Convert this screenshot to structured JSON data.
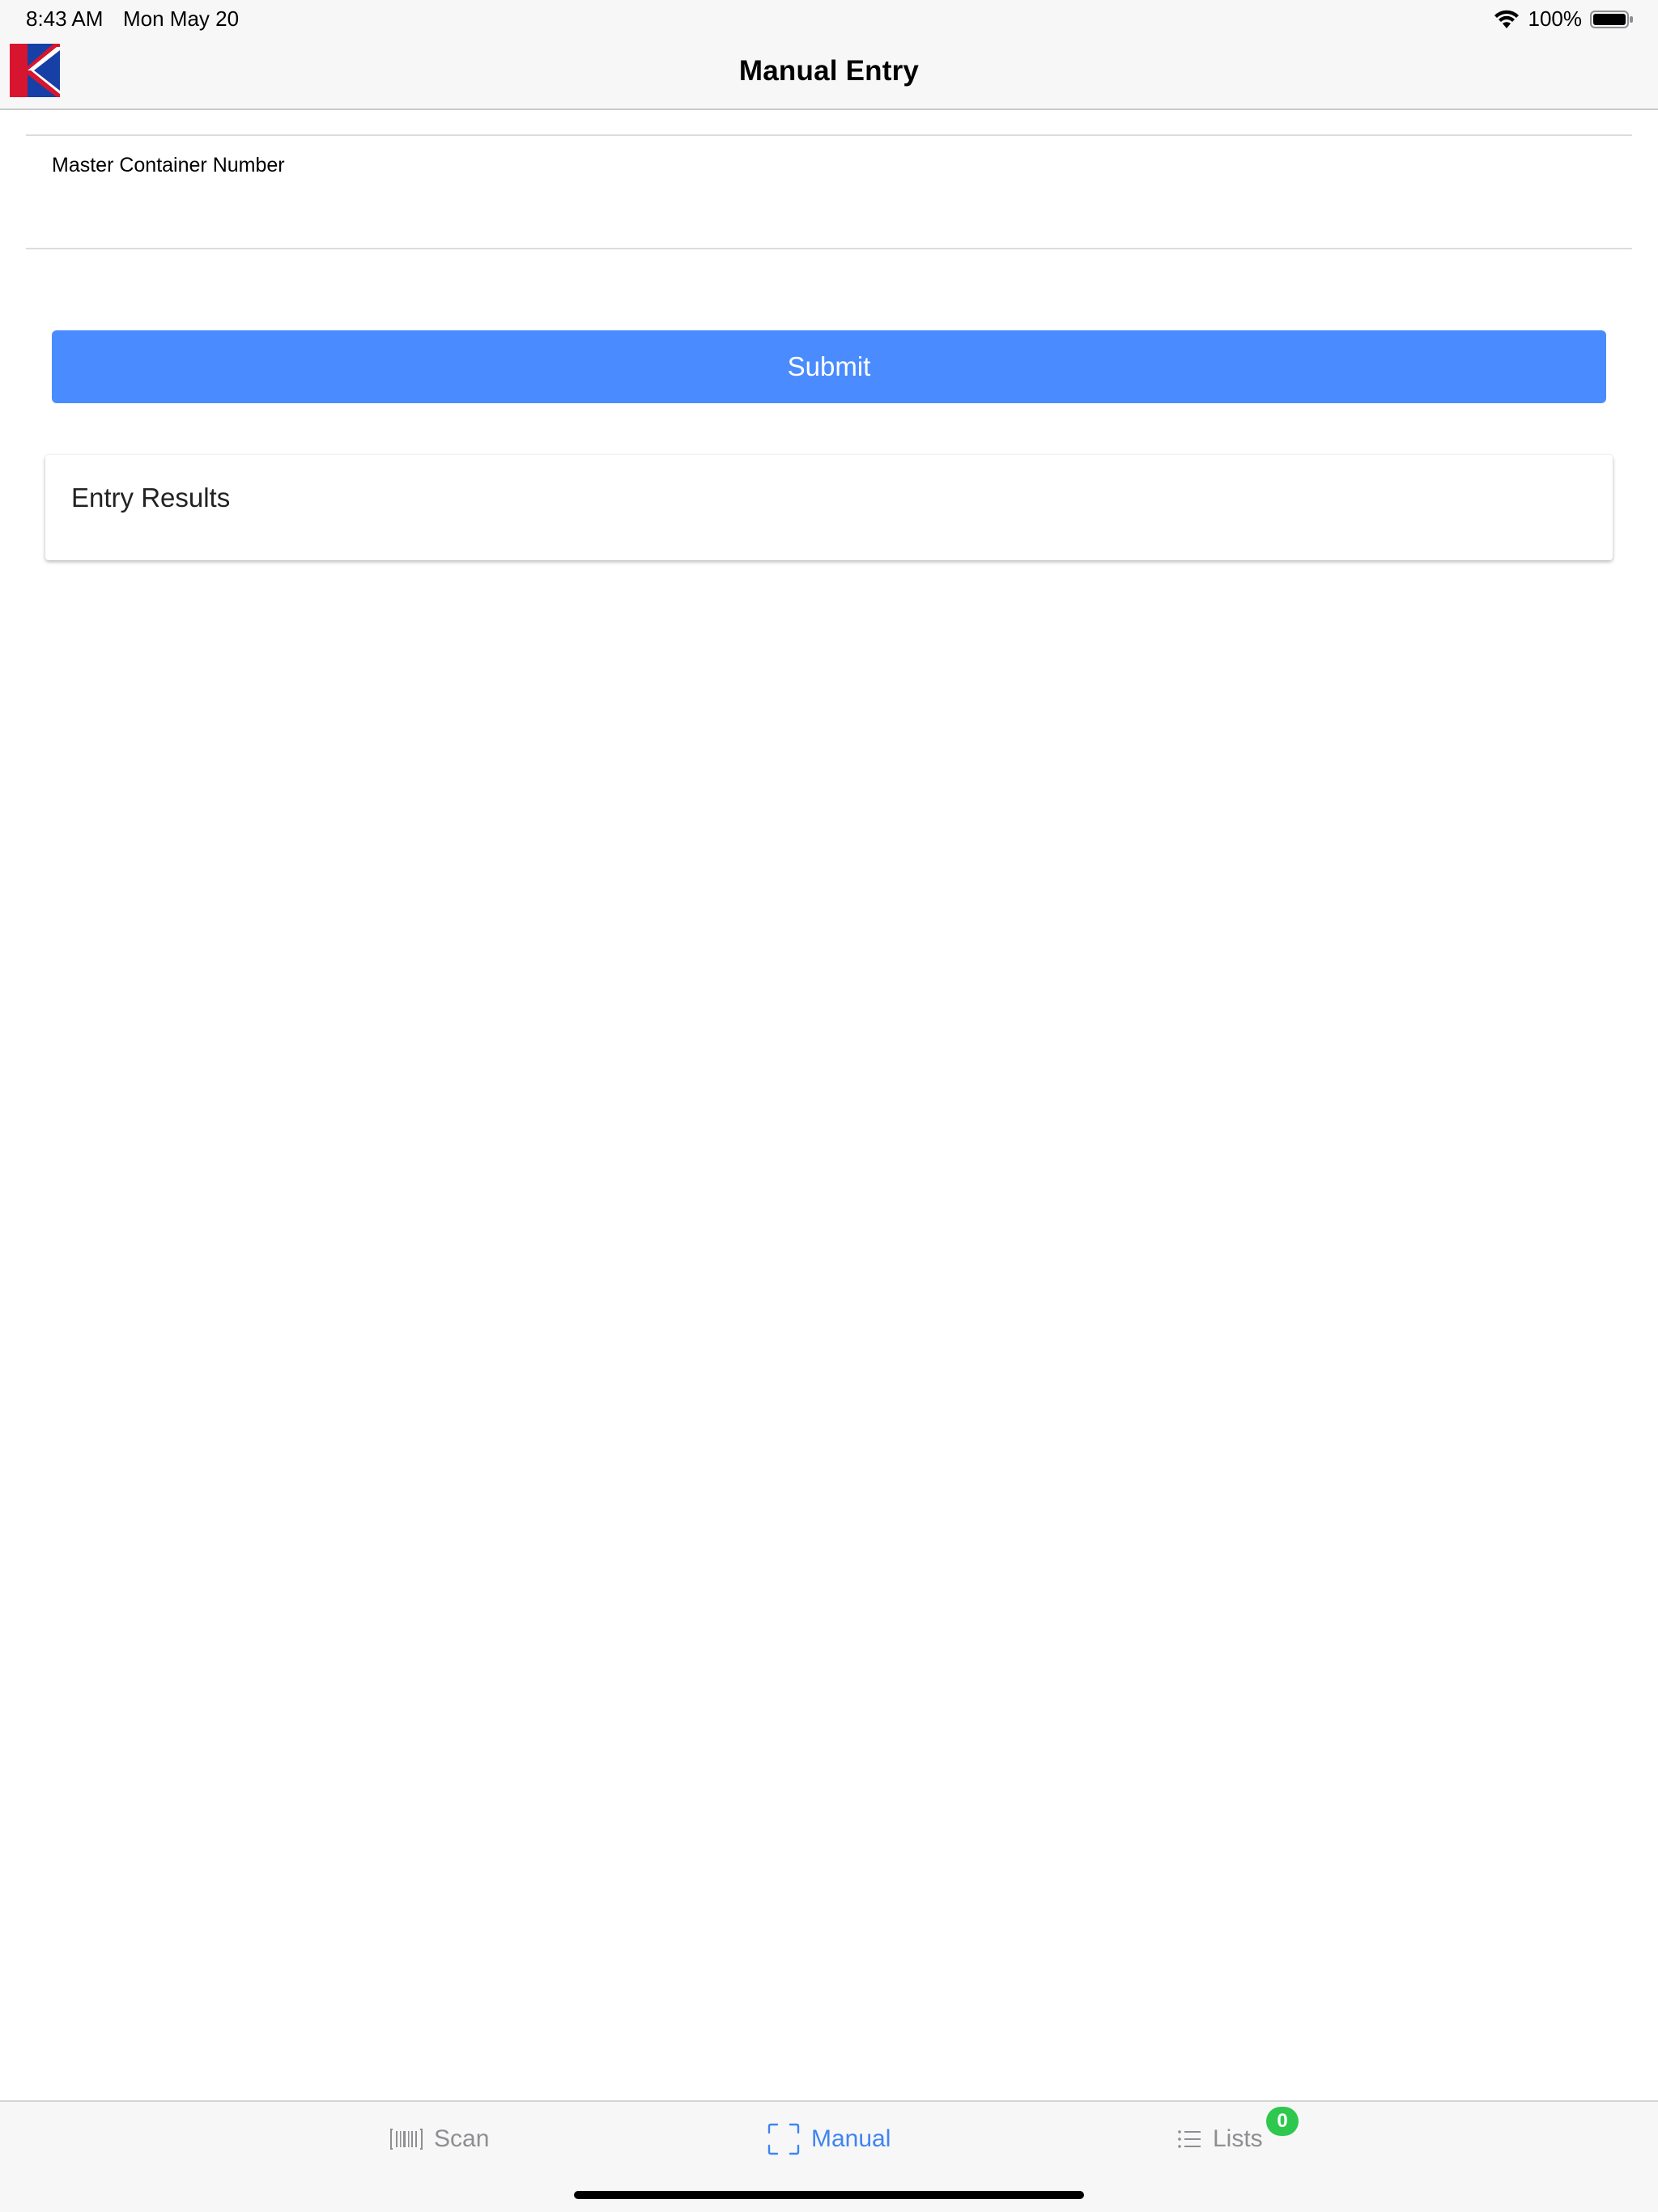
{
  "status_bar": {
    "time": "8:43 AM",
    "date": "Mon May 20",
    "battery": "100%"
  },
  "header": {
    "title": "Manual Entry",
    "logo_icon": "k-logo-icon"
  },
  "form": {
    "field_label": "Master Container Number",
    "field_value": "",
    "submit_label": "Submit"
  },
  "results": {
    "title": "Entry Results"
  },
  "tab_bar": {
    "tabs": [
      {
        "label": "Scan",
        "icon": "barcode-icon",
        "active": false
      },
      {
        "label": "Manual",
        "icon": "scan-frame-icon",
        "active": true
      },
      {
        "label": "Lists",
        "icon": "list-icon",
        "active": false
      }
    ],
    "lists_badge": "0"
  },
  "colors": {
    "accent": "#4a8cff",
    "active_tab": "#3f85f2",
    "badge": "#2dc84d",
    "logo_red": "#d7152f",
    "logo_blue": "#1740a6"
  }
}
